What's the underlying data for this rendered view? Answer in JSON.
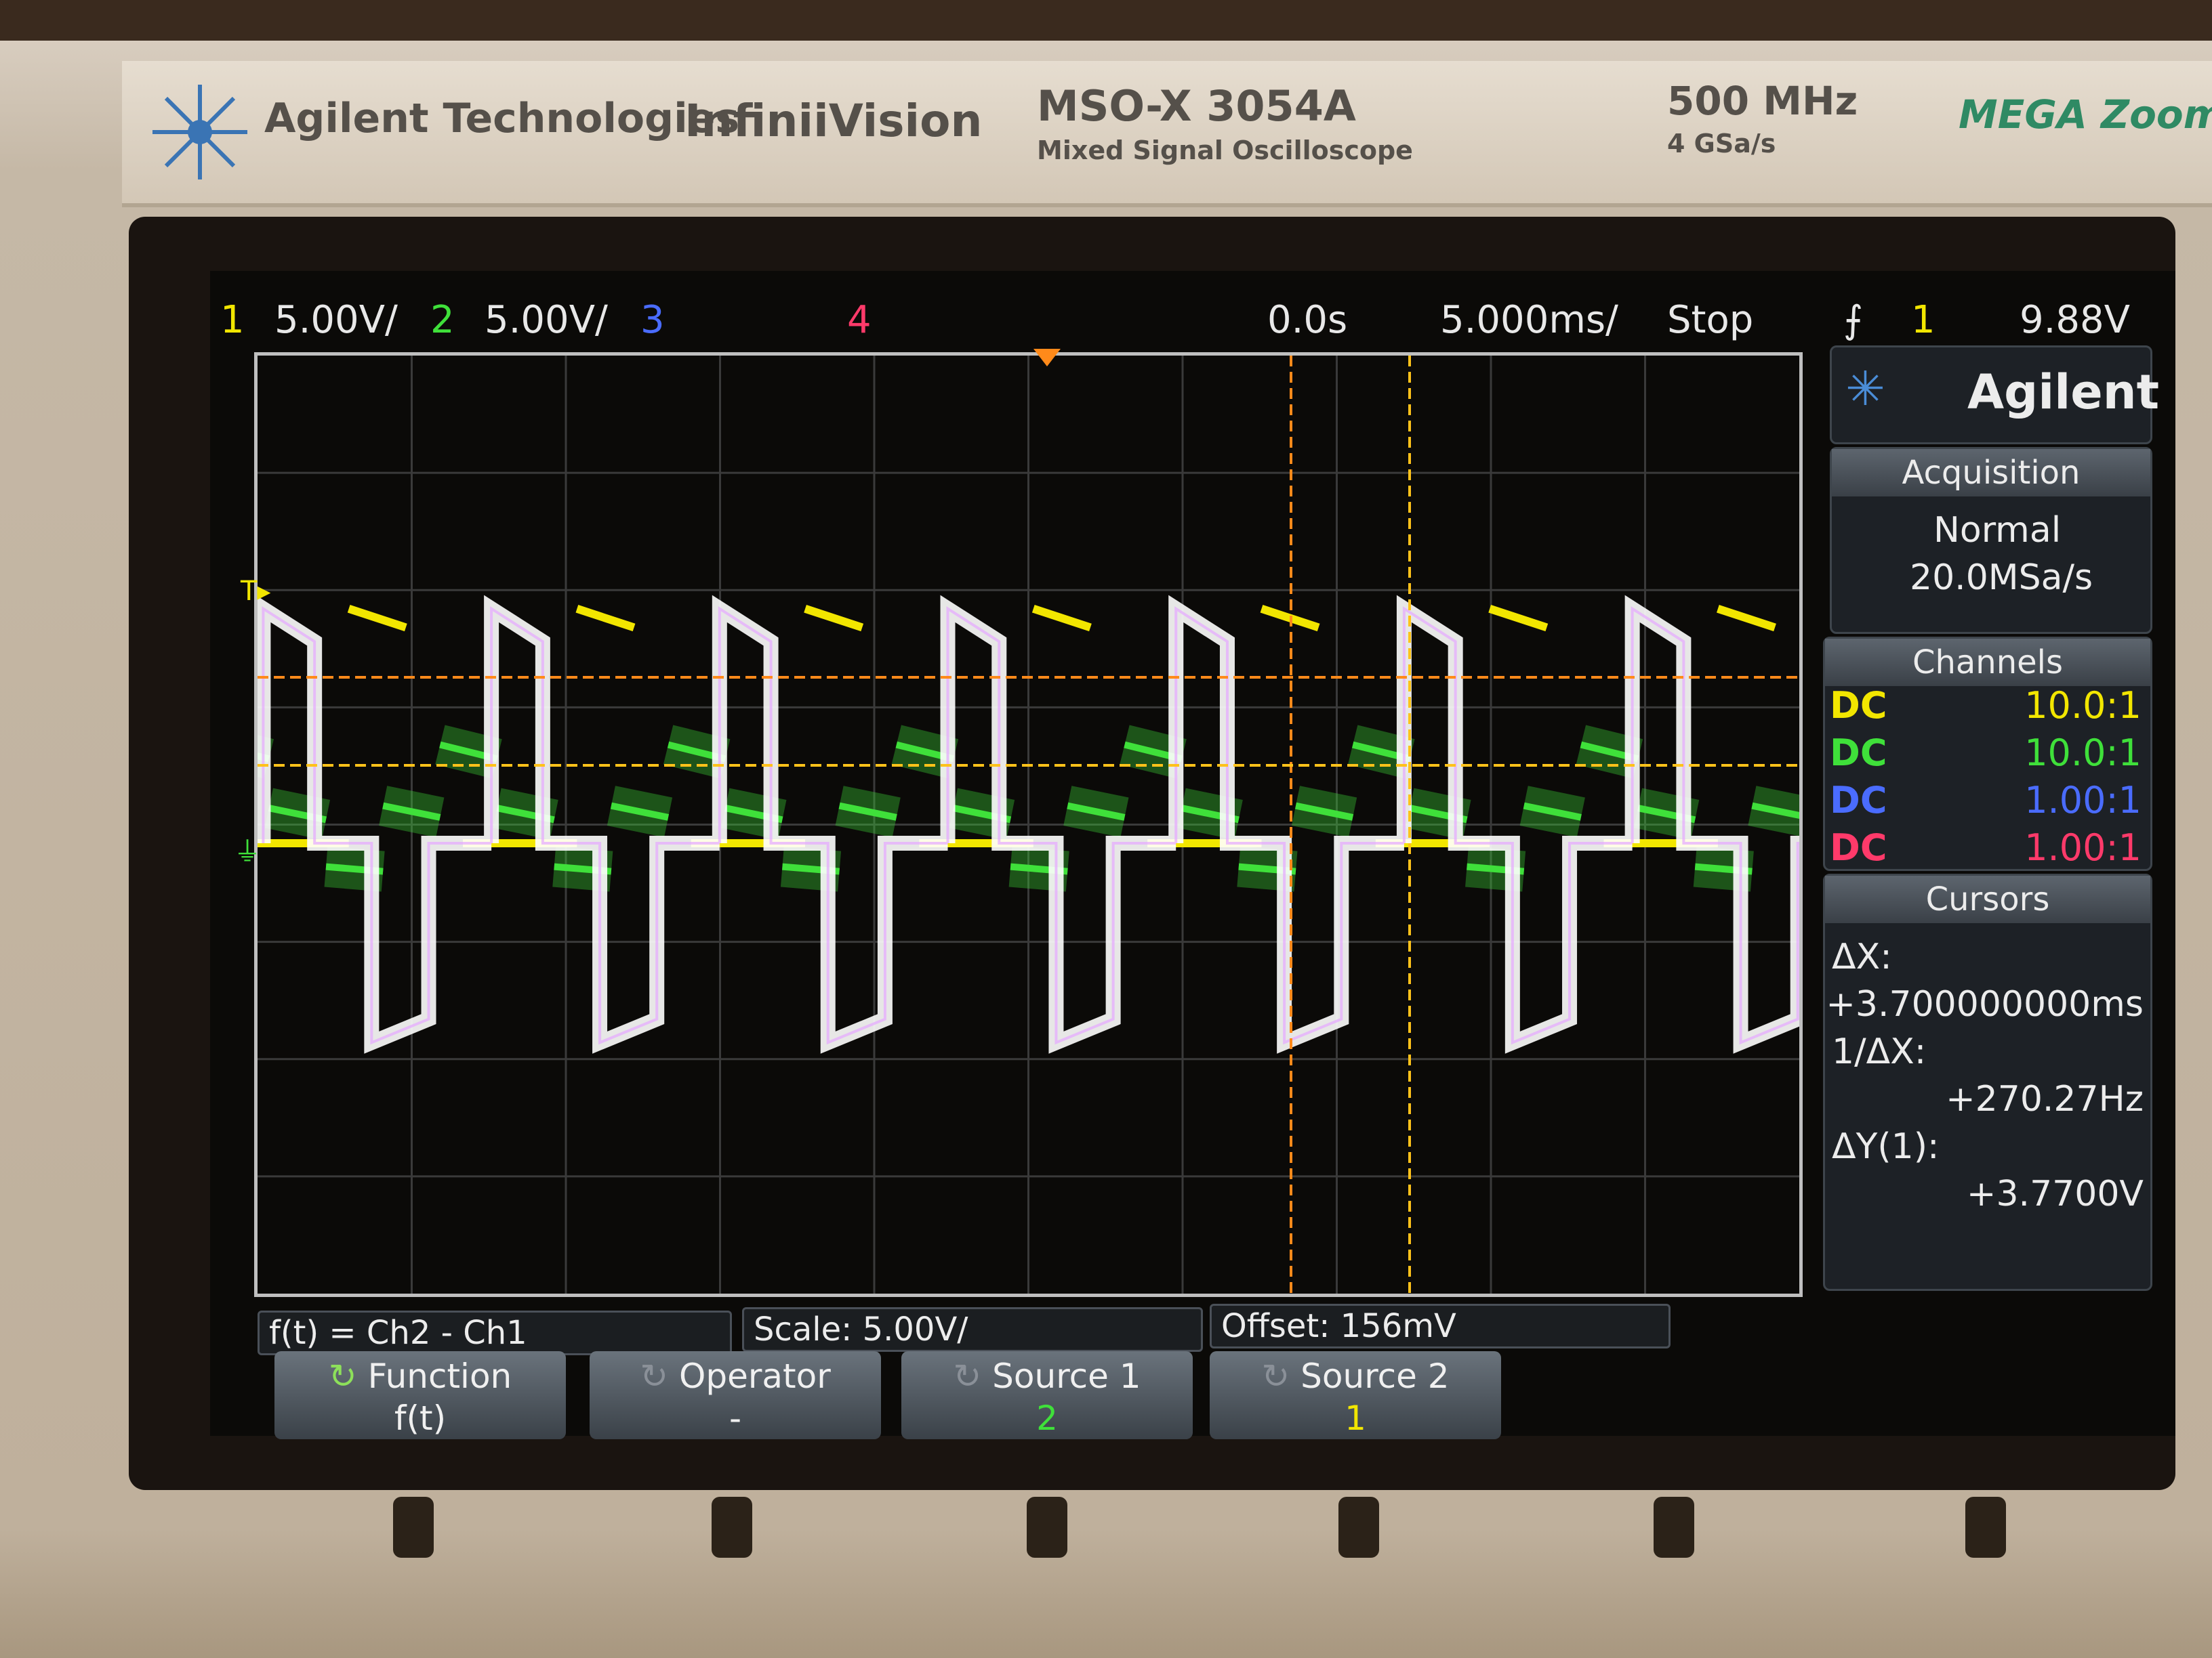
{
  "device": {
    "brand": "Agilent Technologies",
    "series": "InfiniiVision",
    "model": "MSO-X 3054A",
    "model_desc": "Mixed Signal Oscilloscope",
    "bandwidth": "500 MHz",
    "sample_rate": "4 GSa/s",
    "tag": "MEGA Zoom"
  },
  "status_bar": {
    "ch1_num": "1",
    "ch1_scale": "5.00V/",
    "ch2_num": "2",
    "ch2_scale": "5.00V/",
    "ch3_num": "3",
    "ch4_num": "4",
    "time_delay": "0.0s",
    "time_scale": "5.000ms/",
    "run_state": "Stop",
    "trigger_icon": "trigger-edge-icon",
    "trigger_src": "1",
    "trigger_level": "9.88V"
  },
  "side_panel": {
    "logo": "Agilent",
    "acquisition_title": "Acquisition",
    "acq_mode": "Normal",
    "acq_rate": "20.0MSa/s",
    "channels_title": "Channels",
    "channels": [
      {
        "coupling": "DC",
        "ratio": "10.0:1",
        "color": "#f2e600"
      },
      {
        "coupling": "DC",
        "ratio": "10.0:1",
        "color": "#3fe03a"
      },
      {
        "coupling": "DC",
        "ratio": "1.00:1",
        "color": "#4a6cff"
      },
      {
        "coupling": "DC",
        "ratio": "1.00:1",
        "color": "#ff3a6a"
      }
    ],
    "cursors_title": "Cursors",
    "dx_label": "ΔX:",
    "dx_value": "+3.700000000ms",
    "inv_dx_label": "1/ΔX:",
    "inv_dx_value": "+270.27Hz",
    "dy_label": "ΔY(1):",
    "dy_value": "+3.7700V"
  },
  "math_bar": {
    "function_expr": "f(t) = Ch2 - Ch1",
    "scale": "Scale: 5.00V/",
    "offset": "Offset: 156mV"
  },
  "softkeys": [
    {
      "label": "Function",
      "value": "f(t)"
    },
    {
      "label": "Operator",
      "value": "-"
    },
    {
      "label": "Source 1",
      "value": "2"
    },
    {
      "label": "Source 2",
      "value": "1"
    }
  ],
  "colors": {
    "ch1": "#f2e600",
    "ch2": "#3fe03a",
    "ch3": "#4a6cff",
    "ch4": "#ff3a6a",
    "math": "#ffffff",
    "cursor_a": "#ff8a1a",
    "cursor_b": "#ffc21a"
  },
  "trace_data": {
    "time_per_div_ms": 5,
    "volts_per_div": 5,
    "period_ms": 7.4,
    "ch1_high_v": 10,
    "ch1_low_v": 0,
    "ch2_levels_v": [
      4.2,
      1.5,
      -1.2
    ],
    "math_high_v": 10,
    "math_low_v": -8.5
  }
}
